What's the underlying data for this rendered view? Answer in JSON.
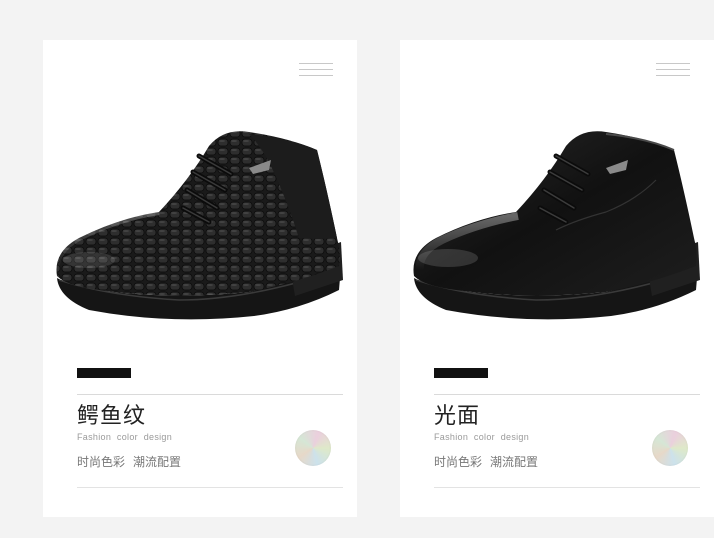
{
  "cards": [
    {
      "title": "鳄鱼纹",
      "subtitle_en": "Fashion color design",
      "subtitle_cn_a": "时尚色彩",
      "subtitle_cn_b": "潮流配置",
      "shoe_variant": "crocodile-pattern-leather-boot",
      "color_icon": "color-swatch-icon"
    },
    {
      "title": "光面",
      "subtitle_en": "Fashion color design",
      "subtitle_cn_a": "时尚色彩",
      "subtitle_cn_b": "潮流配置",
      "shoe_variant": "smooth-leather-boot",
      "color_icon": "color-swatch-icon"
    }
  ],
  "colors": {
    "background": "#f3f3f3",
    "card": "#ffffff",
    "accent_bar": "#111111",
    "title_text": "#222222",
    "muted_text": "#9a9a9a"
  }
}
